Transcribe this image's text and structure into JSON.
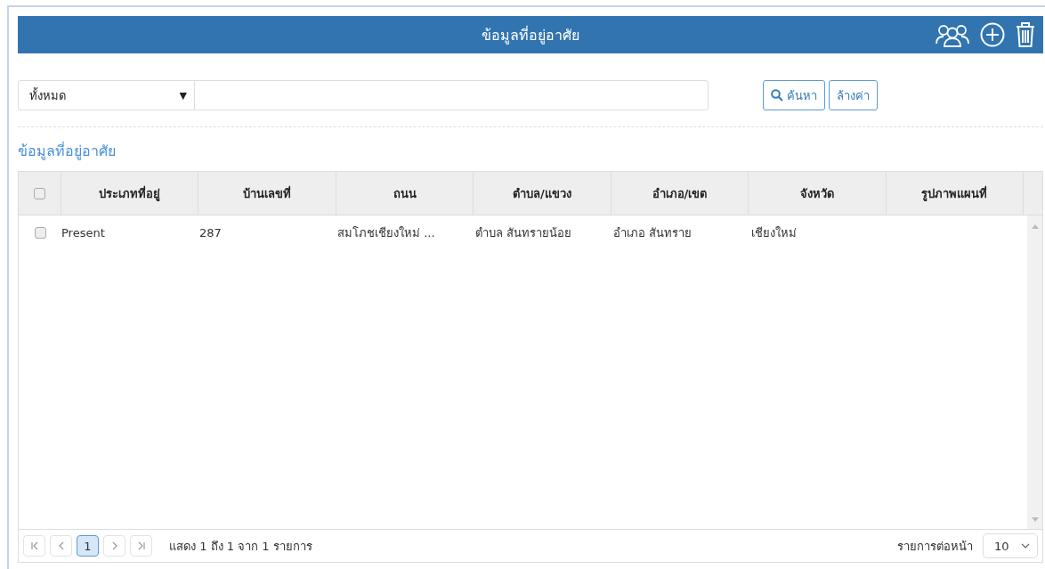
{
  "header": {
    "title": "ข้อมูลที่อยู่อาศัย"
  },
  "filter": {
    "select_value": "ทั้งหมด",
    "select_arrow": "▼",
    "search_button": "ค้นหา",
    "clear_button": "ล้างค่า"
  },
  "section_title": "ข้อมูลที่อยู่อาศัย",
  "table": {
    "select_all_checked": false,
    "columns": [
      "ประเภทที่อยู่",
      "บ้านเลขที่",
      "ถนน",
      "ตำบล/แขวง",
      "อำเภอ/เขต",
      "จังหวัด",
      "รูปภาพแผนที่"
    ],
    "rows": [
      {
        "checked": false,
        "cells": [
          "Present",
          "287",
          "สมโภชเชียงใหม่ ...",
          "ตำบล สันทรายน้อย",
          "อำเภอ สันทราย",
          "เชียงใหม่",
          ""
        ]
      }
    ]
  },
  "pager": {
    "pages": [
      {
        "label": "1",
        "selected": true
      }
    ],
    "summary": "แสดง 1 ถึง 1 จาก 1 รายการ",
    "per_page_label": "รายการต่อหน้า",
    "per_page_value": "10"
  }
}
